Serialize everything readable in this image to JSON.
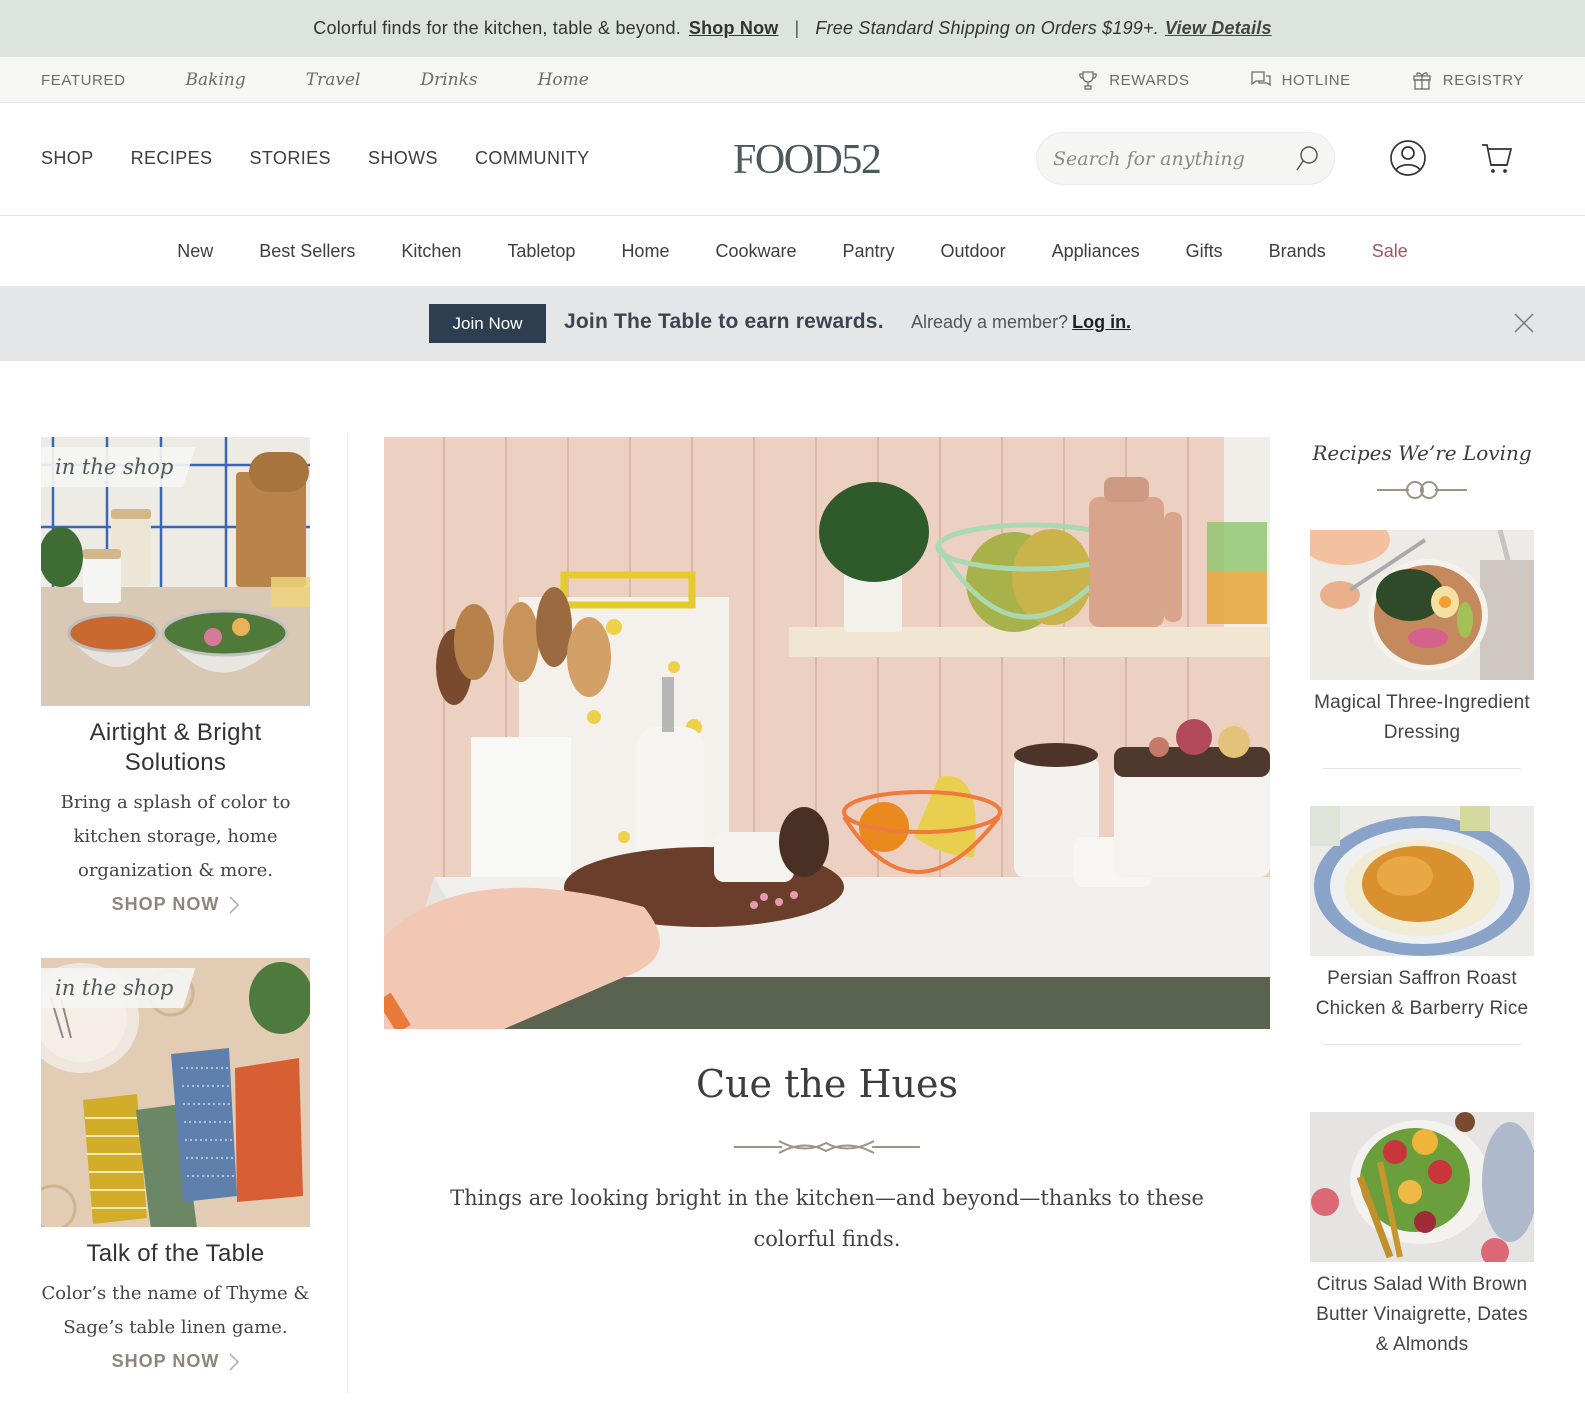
{
  "promo_bar": {
    "message": "Colorful finds for the kitchen, table & beyond.",
    "shop_link": "Shop Now",
    "separator": "|",
    "shipping": "Free Standard Shipping on Orders $199+.",
    "details_link": "View Details",
    "bg_color": "#dde4de"
  },
  "utility_bar": {
    "featured_label": "FEATURED",
    "categories": [
      "Baking",
      "Travel",
      "Drinks",
      "Home"
    ],
    "right_items": [
      {
        "label": "REWARDS",
        "icon": "trophy-icon"
      },
      {
        "label": "HOTLINE",
        "icon": "chat-icon"
      },
      {
        "label": "REGISTRY",
        "icon": "gift-icon"
      }
    ]
  },
  "header": {
    "nav": [
      "SHOP",
      "RECIPES",
      "STORIES",
      "SHOWS",
      "COMMUNITY"
    ],
    "logo": "FOOD52",
    "search_placeholder": "Search for anything",
    "account_icon": "user-icon",
    "cart_icon": "cart-icon"
  },
  "category_nav": {
    "items": [
      "New",
      "Best Sellers",
      "Kitchen",
      "Tabletop",
      "Home",
      "Cookware",
      "Pantry",
      "Outdoor",
      "Appliances",
      "Gifts",
      "Brands",
      "Sale"
    ],
    "sale_color": "#a3555d"
  },
  "join_banner": {
    "button": "Join Now",
    "message": "Join The Table to earn rewards.",
    "already": "Already a member?",
    "login_link": "Log in.",
    "button_color": "#2c3e50"
  },
  "left_column": {
    "cards": [
      {
        "tag": "in the shop",
        "title": "Airtight & Bright Solutions",
        "description": "Bring a splash of color to kitchen storage, home organization & more.",
        "cta": "SHOP NOW"
      },
      {
        "tag": "in the shop",
        "title": "Talk of the Table",
        "description": "Color’s the name of Thyme & Sage’s table linen game.",
        "cta": "SHOP NOW"
      }
    ]
  },
  "hero": {
    "title": "Cue the Hues",
    "description": "Things are looking bright in the kitchen—and beyond—thanks to these colorful finds."
  },
  "right_column": {
    "title": "Recipes We’re Loving",
    "recipes": [
      {
        "name": "Magical Three-Ingredient Dressing"
      },
      {
        "name": "Persian Saffron Roast Chicken & Barberry Rice"
      },
      {
        "name": "Citrus Salad With Brown Butter Vinaigrette, Dates & Almonds"
      }
    ]
  }
}
